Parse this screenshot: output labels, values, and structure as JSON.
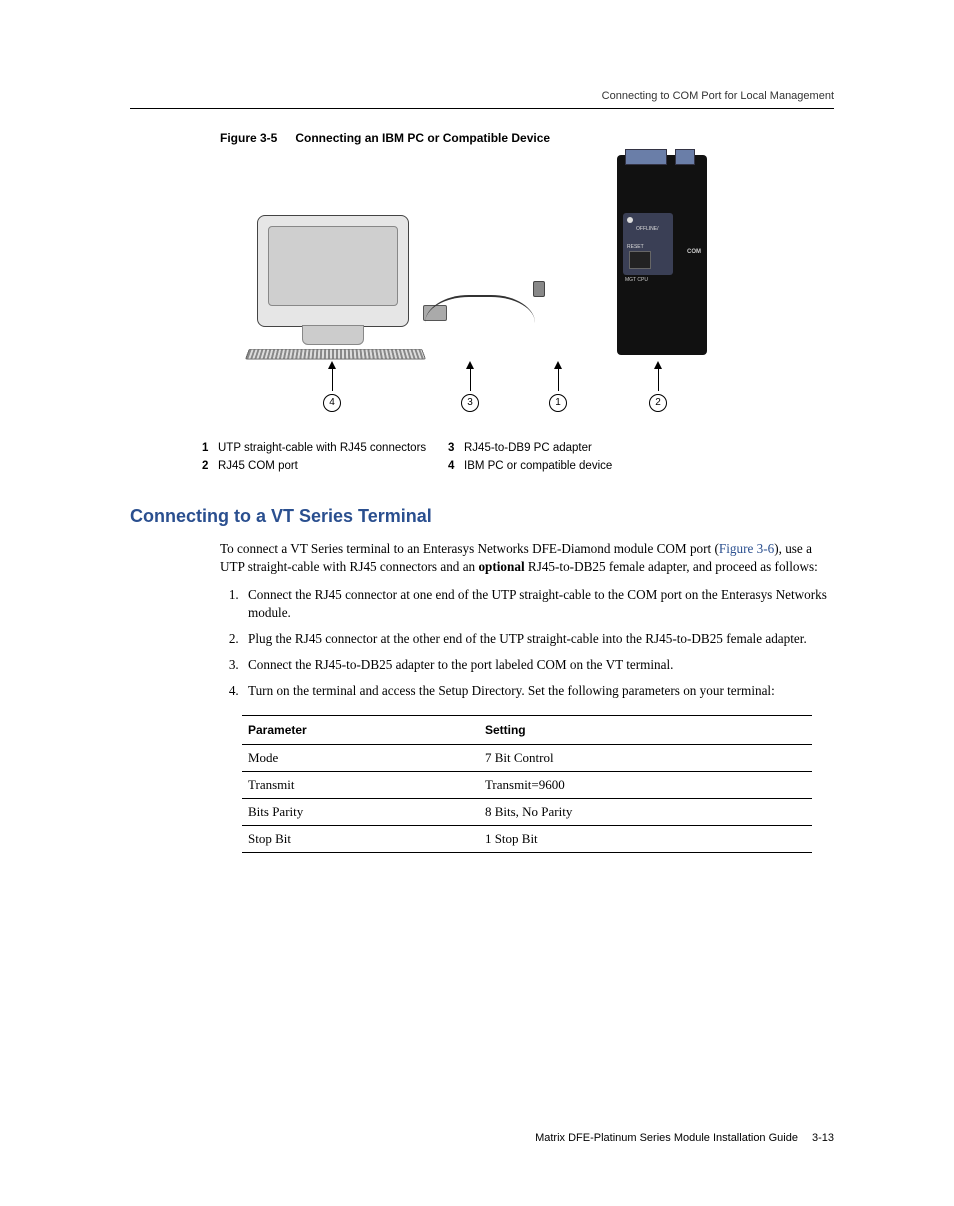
{
  "running_head": "Connecting to COM Port for Local Management",
  "figure": {
    "label": "Figure 3-5",
    "title": "Connecting an IBM PC or Compatible Device",
    "module_labels": {
      "offline_reset": "OFFLINE/\nRESET",
      "com": "COM",
      "mgt_cpu": "MGT      CPU"
    },
    "callouts": [
      "4",
      "3",
      "1",
      "2"
    ]
  },
  "legend": [
    {
      "n1": "1",
      "t1": "UTP straight-cable with RJ45 connectors",
      "n2": "3",
      "t2": "RJ45-to-DB9 PC adapter"
    },
    {
      "n1": "2",
      "t1": "RJ45 COM port",
      "n2": "4",
      "t2": "IBM PC or compatible device"
    }
  ],
  "section_heading": "Connecting to a VT Series Terminal",
  "intro": {
    "pre_link": "To connect a VT Series terminal to an Enterasys Networks DFE-Diamond module COM port (",
    "link": "Figure 3-6",
    "post_link": "), use a UTP straight-cable with RJ45 connectors and an ",
    "bold": "optional",
    "tail": " RJ45-to-DB25 female adapter, and proceed as follows:"
  },
  "steps": [
    "Connect the RJ45 connector at one end of the UTP straight-cable to the COM port on the Enterasys Networks module.",
    "Plug the RJ45 connector at the other end of the UTP straight-cable into the RJ45-to-DB25 female adapter.",
    "Connect the RJ45-to-DB25 adapter to the port labeled COM on the VT terminal.",
    "Turn on the terminal and access the Setup Directory. Set the following parameters on your terminal:"
  ],
  "table": {
    "headers": [
      "Parameter",
      "Setting"
    ],
    "rows": [
      [
        "Mode",
        "7 Bit Control"
      ],
      [
        "Transmit",
        "Transmit=9600"
      ],
      [
        "Bits Parity",
        "8 Bits, No Parity"
      ],
      [
        "Stop Bit",
        "1 Stop Bit"
      ]
    ]
  },
  "footer": {
    "book": "Matrix DFE-Platinum Series Module Installation Guide",
    "page": "3-13"
  }
}
